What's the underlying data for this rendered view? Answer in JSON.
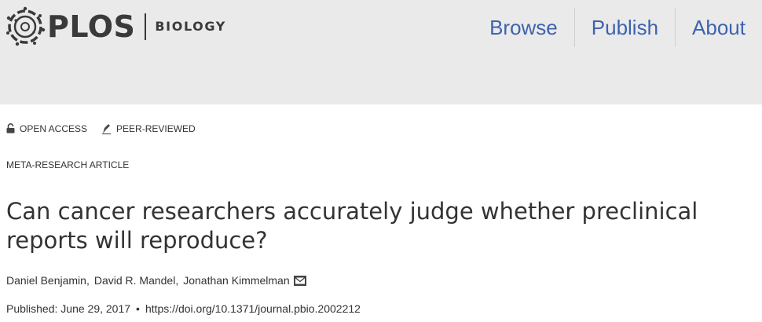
{
  "header": {
    "logo": {
      "brand": "PLOS",
      "journal": "BIOLOGY"
    },
    "nav": [
      {
        "label": "Browse"
      },
      {
        "label": "Publish"
      },
      {
        "label": "About"
      }
    ]
  },
  "badges": {
    "open_access": "OPEN ACCESS",
    "peer_reviewed": "PEER-REVIEWED"
  },
  "article": {
    "type": "META-RESEARCH ARTICLE",
    "title": "Can cancer researchers accurately judge whether preclinical reports will reproduce?",
    "authors": [
      {
        "name": "Daniel Benjamin"
      },
      {
        "name": "David R. Mandel"
      },
      {
        "name": "Jonathan Kimmelman"
      }
    ],
    "published_label": "Published:",
    "published_date": "June 29, 2017",
    "doi": "https://doi.org/10.1371/journal.pbio.2002212"
  },
  "icons": {
    "logo_mark": "plos-globe-icon",
    "open_access": "open-lock-icon",
    "peer_reviewed": "pen-nib-icon",
    "contact": "envelope-icon"
  },
  "colors": {
    "header_bg": "#eaeaea",
    "nav_link": "#3c63af",
    "text": "#333333"
  }
}
